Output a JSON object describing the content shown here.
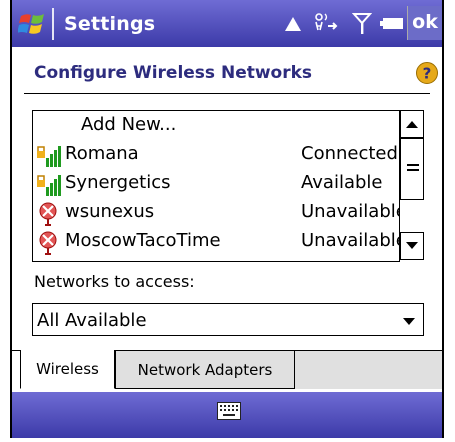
{
  "titlebar": {
    "title": "Settings",
    "ok_label": "ok"
  },
  "page": {
    "title": "Configure Wireless Networks"
  },
  "networks": {
    "add_new_label": "Add New...",
    "items": [
      {
        "name": "Romana",
        "status": "Connected",
        "icon": "signal-bars-icon"
      },
      {
        "name": "Synergetics",
        "status": "Available",
        "icon": "signal-bars-icon"
      },
      {
        "name": "wsunexus",
        "status": "Unavailable",
        "icon": "network-unavailable-icon"
      },
      {
        "name": "MoscowTacoTime",
        "status": "Unavailable",
        "icon": "network-unavailable-icon"
      }
    ]
  },
  "access": {
    "label": "Networks to access:",
    "selected": "All Available"
  },
  "tabs": [
    {
      "label": "Wireless",
      "active": true
    },
    {
      "label": "Network Adapters",
      "active": false
    }
  ],
  "colors": {
    "bar": "#4b49b8",
    "title_text": "#2d2c7e"
  }
}
